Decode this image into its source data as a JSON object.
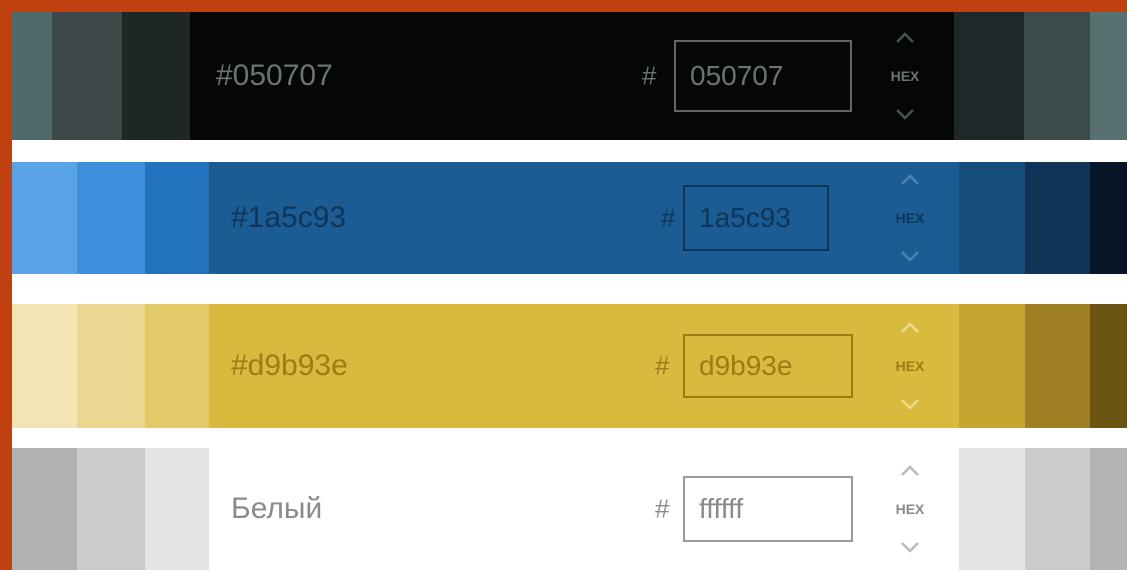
{
  "rows": [
    {
      "name": "#050707",
      "hash": "#",
      "value": "050707",
      "format": "HEX",
      "main_color": "#050707",
      "text_color": "#6c7373",
      "field_border": "#5f6767",
      "chevron_color": "#4a5353",
      "left_swatches": [
        "#4f6a6a",
        "#3c4848",
        "#1e2626"
      ],
      "right_swatches": [
        "#1f2828",
        "#3d4a4a",
        "#577070"
      ]
    },
    {
      "name": "#1a5c93",
      "hash": "#",
      "value": "1a5c93",
      "format": "HEX",
      "main_color": "#1a5c93",
      "text_color": "#0f3558",
      "field_border": "#0f3558",
      "chevron_color": "#4d86b5",
      "left_swatches": [
        "#5aa3e6",
        "#3d90dc",
        "#2373bc"
      ],
      "right_swatches": [
        "#164d7b",
        "#0f3458",
        "#071627"
      ]
    },
    {
      "name": "#d9b93e",
      "hash": "#",
      "value": "d9b93e",
      "format": "HEX",
      "main_color": "#d9b93e",
      "text_color": "#9a7d15",
      "field_border": "#9a7d15",
      "chevron_color": "#f1dc8e",
      "left_swatches": [
        "#f3e4b4",
        "#ebd791",
        "#e3c968"
      ],
      "right_swatches": [
        "#c7a530",
        "#9f7f23",
        "#6b5314"
      ]
    },
    {
      "name": "Белый",
      "hash": "#",
      "value": "ffffff",
      "format": "HEX",
      "main_color": "#ffffff",
      "text_color": "#8a8a8a",
      "field_border": "#9a9a9a",
      "chevron_color": "#bbbbbb",
      "left_swatches": [
        "#b2b2b2",
        "#cbcbcb",
        "#e4e4e4"
      ],
      "right_swatches": [
        "#e4e4e4",
        "#cbcbcb",
        "#b3b3b3"
      ]
    }
  ]
}
